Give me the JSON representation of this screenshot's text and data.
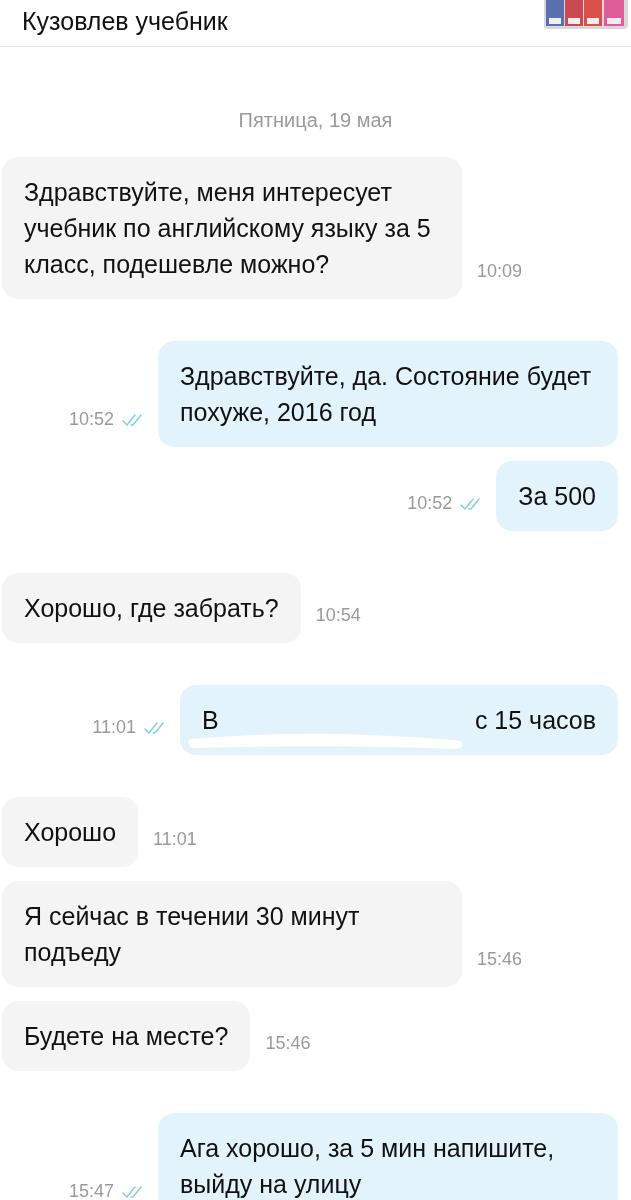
{
  "header": {
    "title": "Кузовлев учебник"
  },
  "date_divider": "Пятница, 19 мая",
  "messages": [
    {
      "kind": "in",
      "text": "Здравствуйте, меня интересует учебник по английскому языку за 5 класс, подешевле можно?",
      "time": "10:09"
    },
    {
      "kind": "out",
      "text": "Здравствуйте, да.  Состояние будет похуже,  2016 год",
      "time": "10:52",
      "read": true
    },
    {
      "kind": "out",
      "text": "За 500",
      "time": "10:52",
      "read": true
    },
    {
      "kind": "in",
      "text": "Хорошо, где забрать?",
      "time": "10:54"
    },
    {
      "kind": "out_redacted",
      "text_start": "В",
      "text_end": "с 15 часов",
      "time": "11:01",
      "read": true
    },
    {
      "kind": "in",
      "text": "Хорошо",
      "time": "11:01"
    },
    {
      "kind": "in",
      "text": "Я сейчас в течении 30 минут подъеду",
      "time": "15:46"
    },
    {
      "kind": "in",
      "text": "Будете на месте?",
      "time": "15:46"
    },
    {
      "kind": "out",
      "text": "Ага хорошо, за 5 мин напишите, выйду на улицу",
      "time": "15:47",
      "read": true
    }
  ]
}
